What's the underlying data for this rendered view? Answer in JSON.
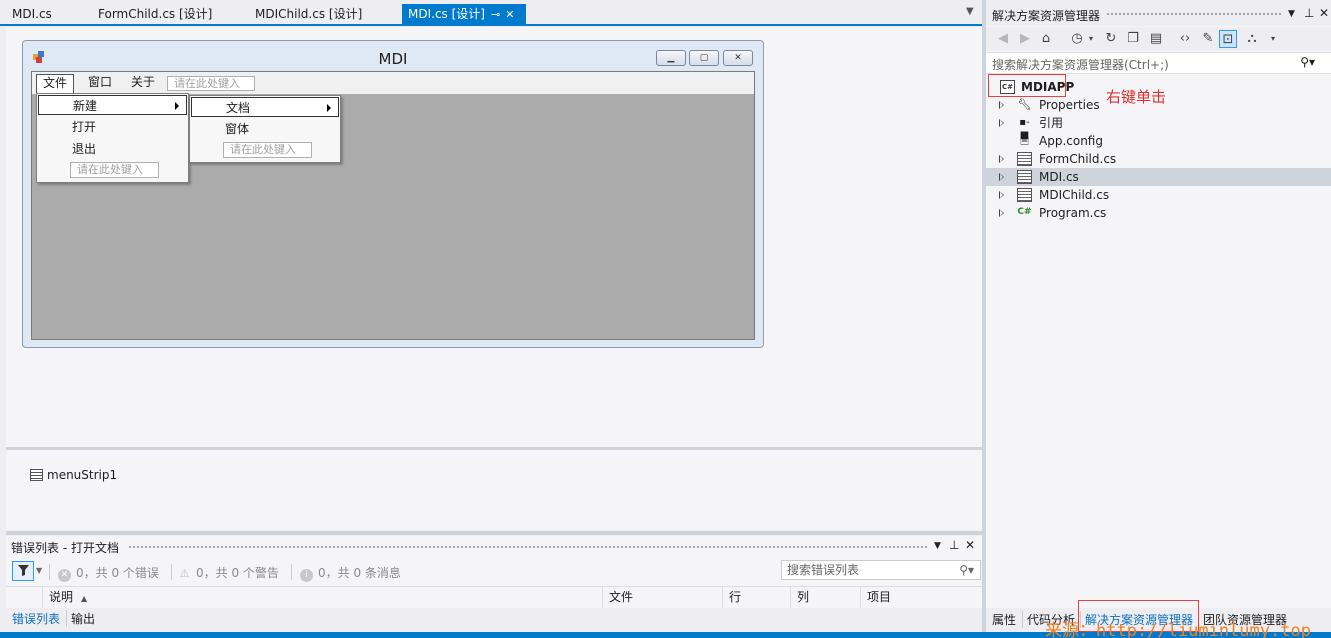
{
  "doc_tabs": [
    {
      "label": "MDI.cs"
    },
    {
      "label": "FormChild.cs [设计]"
    },
    {
      "label": "MDIChild.cs [设计]"
    },
    {
      "label": "MDI.cs [设计]",
      "active": true
    }
  ],
  "form": {
    "title": "MDI",
    "menu": [
      "文件",
      "窗口",
      "关于"
    ],
    "type_here": "请在此处键入",
    "file_menu": [
      "新建",
      "打开",
      "退出"
    ],
    "new_submenu": [
      "文档",
      "窗体"
    ]
  },
  "tray": {
    "component": "menuStrip1"
  },
  "error_list": {
    "title": "错误列表 - 打开文档",
    "errors": "0，共 0 个错误",
    "warnings": "0，共 0 个警告",
    "messages": "0，共 0 条消息",
    "search_placeholder": "搜索错误列表",
    "columns": [
      "说明",
      "文件",
      "行",
      "列",
      "项目"
    ]
  },
  "bottom_tabs": [
    "错误列表",
    "输出"
  ],
  "solution_explorer": {
    "title": "解决方案资源管理器",
    "search_placeholder": "搜索解决方案资源管理器(Ctrl+;)",
    "project": "MDIAPP",
    "annotation": "右键单击",
    "items": [
      {
        "label": "Properties",
        "icon": "wrench-icon",
        "expandable": true
      },
      {
        "label": "引用",
        "icon": "references-icon",
        "expandable": true
      },
      {
        "label": "App.config",
        "icon": "config-icon",
        "expandable": false
      },
      {
        "label": "FormChild.cs",
        "icon": "form-file-icon",
        "expandable": true
      },
      {
        "label": "MDI.cs",
        "icon": "form-file-icon",
        "expandable": true,
        "selected": true
      },
      {
        "label": "MDIChild.cs",
        "icon": "form-file-icon",
        "expandable": true
      },
      {
        "label": "Program.cs",
        "icon": "csharp-file-icon",
        "expandable": true
      }
    ]
  },
  "se_tabs": [
    "属性",
    "代码分析",
    "解决方案资源管理器",
    "团队资源管理器"
  ],
  "watermark": "来源：http://liuminlumy.top",
  "colors": {
    "accent": "#007acc",
    "annotation": "#e03030",
    "watermark": "#f08020"
  }
}
